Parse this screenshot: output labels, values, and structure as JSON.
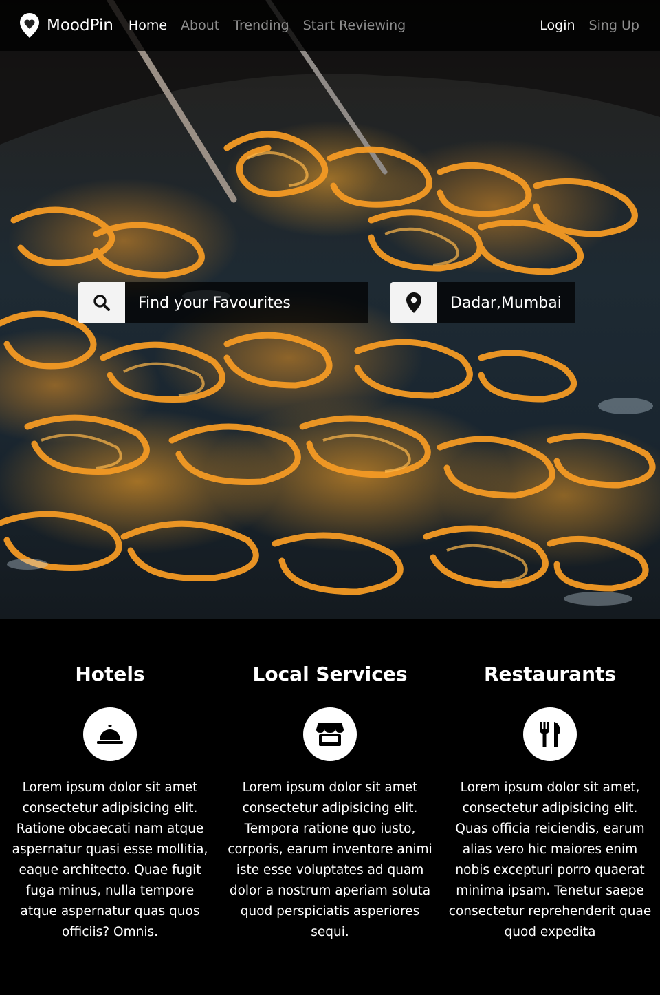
{
  "brand": {
    "name": "MoodPin",
    "icon": "map-pin-icon"
  },
  "nav": {
    "links": [
      {
        "label": "Home",
        "active": true
      },
      {
        "label": "About",
        "active": false
      },
      {
        "label": "Trending",
        "active": false
      },
      {
        "label": "Start Reviewing",
        "active": false
      }
    ],
    "right": [
      {
        "label": "Login",
        "active": true
      },
      {
        "label": "Sing Up",
        "active": false
      }
    ]
  },
  "search": {
    "find": {
      "icon": "search-icon",
      "value": "Find your Favourites"
    },
    "location": {
      "icon": "map-marker-icon",
      "value": "Dadar,Mumbai"
    }
  },
  "features": [
    {
      "title": "Hotels",
      "icon": "concierge-bell-icon",
      "text": "Lorem ipsum dolor sit amet consectetur adipisicing elit. Ratione obcaecati nam atque aspernatur quasi esse mollitia, eaque architecto. Quae fugit fuga minus, nulla tempore atque aspernatur quas quos officiis? Omnis."
    },
    {
      "title": "Local Services",
      "icon": "store-icon",
      "text": "Lorem ipsum dolor sit amet consectetur adipisicing elit. Tempora ratione quo iusto, corporis, earum inventore animi iste esse voluptates ad quam dolor a nostrum aperiam soluta quod perspiciatis asperiores sequi."
    },
    {
      "title": "Restaurants",
      "icon": "utensils-icon",
      "text": "Lorem ipsum dolor sit amet, consectetur adipisicing elit. Quas officia reiciendis, earum alias vero hic maiores enim nobis excepturi porro quaerat minima ipsam. Tenetur saepe consectetur reprehenderit quae quod expedita"
    }
  ],
  "colors": {
    "navbar_bg": "#000000",
    "nav_inactive": "#8c8c8c",
    "accent_food": "#f39a2a",
    "section_bg": "#000000"
  }
}
